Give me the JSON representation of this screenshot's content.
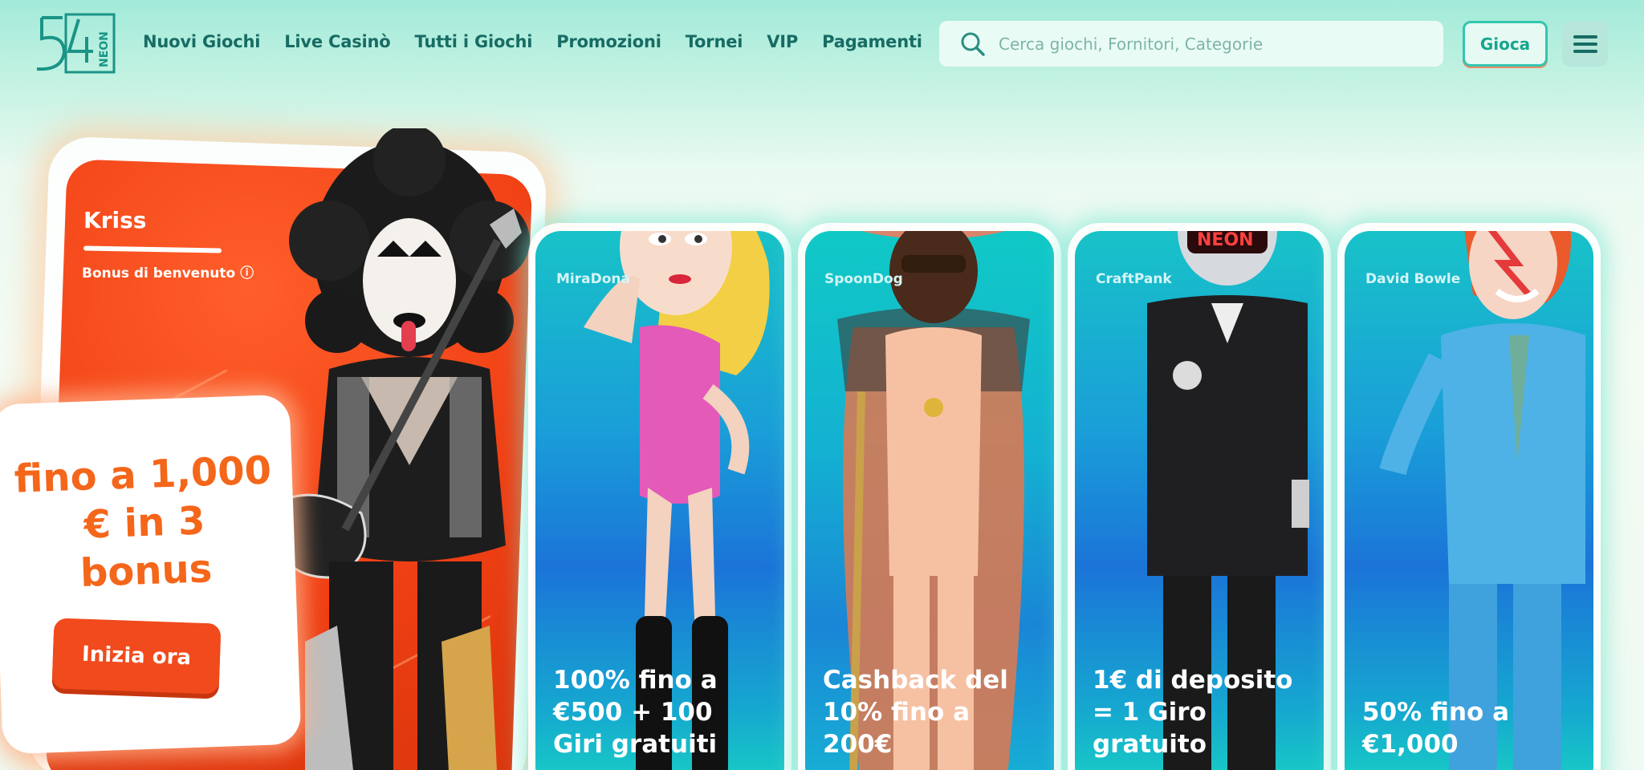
{
  "header": {
    "logo_text": "54 NEON",
    "nav": [
      "Nuovi Giochi",
      "Live Casinò",
      "Tutti i Giochi",
      "Promozioni",
      "Tornei",
      "VIP",
      "Pagamenti"
    ],
    "search_placeholder": "Cerca giochi, Fornitori, Categorie",
    "play_label": "Gioca",
    "menu_icon": "hamburger-icon"
  },
  "hero": {
    "name": "Kriss",
    "bonus_label": "Bonus di benvenuto ⓘ",
    "offer": [
      "fino a 1,000",
      "€ in 3",
      "bonus"
    ],
    "cta": "Inizia ora"
  },
  "cards": [
    {
      "name": "MiraDona",
      "offer": [
        "100% fino a",
        "€500 + 100",
        "Giri gratuiti"
      ]
    },
    {
      "name": "SpoonDog",
      "offer": [
        "Cashback del",
        "10% fino a",
        "200€"
      ]
    },
    {
      "name": "CraftPank",
      "offer": [
        "1€ di deposito",
        "= 1 Giro",
        "gratuito"
      ]
    },
    {
      "name": "David Bowle",
      "offer": [
        "50% fino a",
        "€1,000"
      ]
    }
  ],
  "colors": {
    "brand_teal": "#176c64",
    "hero_orange": "#f03f14",
    "offer_orange": "#f4661a",
    "card_blue": "#1a86d6",
    "accent_mint": "#33c6ae"
  }
}
